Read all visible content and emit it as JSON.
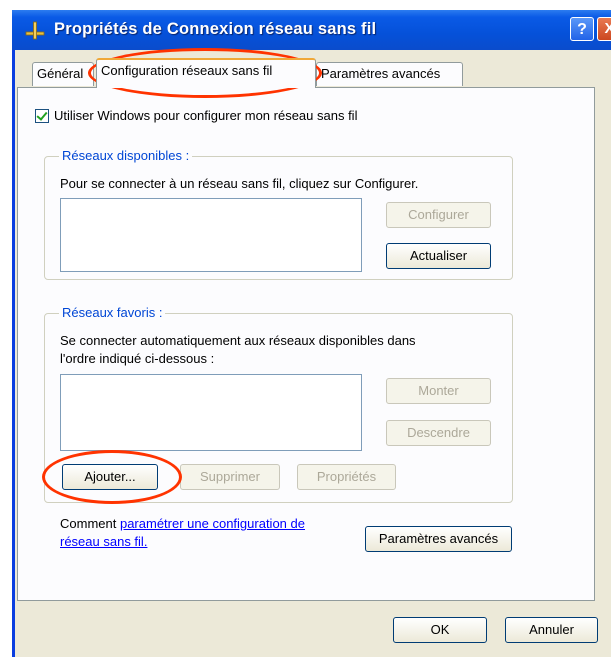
{
  "window": {
    "title": "Propriétés de Connexion réseau sans fil",
    "help": "?",
    "close": "X"
  },
  "tabs": [
    "Général",
    "Configuration réseaux sans fil",
    "Paramètres avancés"
  ],
  "use_windows": "Utiliser Windows pour configurer mon réseau sans fil",
  "available": {
    "title": "Réseaux disponibles :",
    "text": "Pour se connecter à un réseau sans fil, cliquez sur Configurer.",
    "configure": "Configurer",
    "refresh": "Actualiser"
  },
  "preferred": {
    "title": "Réseaux favoris :",
    "text1": "Se connecter automatiquement aux réseaux disponibles dans",
    "text2": "l'ordre indiqué ci-dessous :",
    "up": "Monter",
    "down": "Descendre",
    "add": "Ajouter...",
    "remove": "Supprimer",
    "props": "Propriétés"
  },
  "help": {
    "prefix": "Comment ",
    "link1": "paramétrer une configuration de",
    "link2": "réseau sans fil."
  },
  "advanced_button": "Paramètres avancés",
  "ok": "OK",
  "cancel": "Annuler"
}
